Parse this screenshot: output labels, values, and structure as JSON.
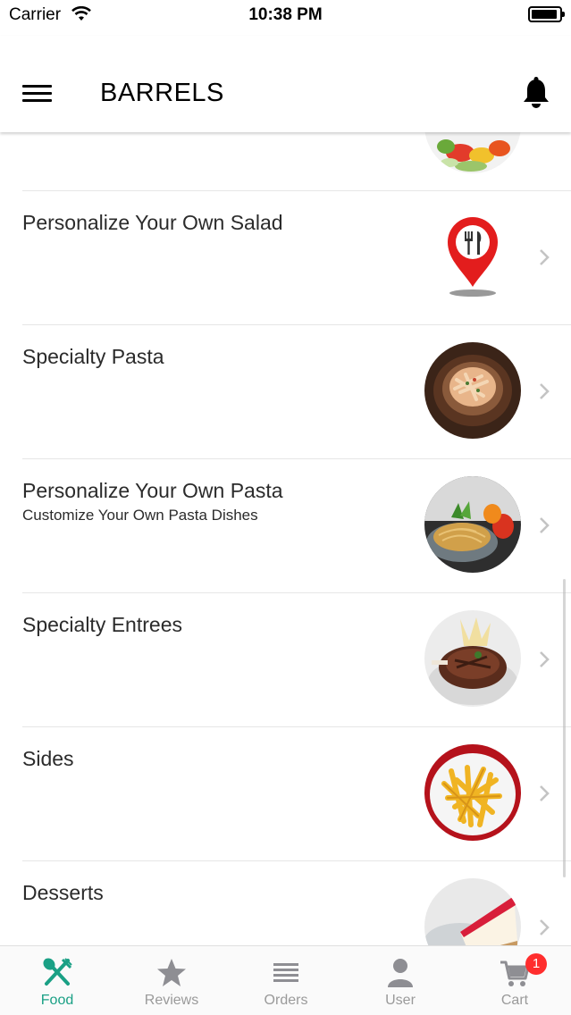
{
  "status_bar": {
    "carrier": "Carrier",
    "time": "10:38 PM"
  },
  "nav": {
    "title": "BARRELS",
    "menu_icon": "hamburger-menu-icon",
    "bell_icon": "bell-icon"
  },
  "menu_categories": [
    {
      "title": "Personalize Your Own Salad",
      "subtitle": "",
      "image": "map-pin-utensils-icon"
    },
    {
      "title": "Specialty Pasta",
      "subtitle": "",
      "image": "pasta-dish-photo"
    },
    {
      "title": "Personalize Your Own Pasta",
      "subtitle": "Customize Your Own Pasta Dishes",
      "image": "spaghetti-bowl-photo"
    },
    {
      "title": "Specialty Entrees",
      "subtitle": "",
      "image": "steak-photo"
    },
    {
      "title": "Sides",
      "subtitle": "",
      "image": "french-fries-photo"
    },
    {
      "title": "Desserts",
      "subtitle": "",
      "image": "cheesecake-photo"
    }
  ],
  "tab_bar": {
    "active_color": "#1aa085",
    "inactive_color": "#9a9a9a",
    "tabs": [
      {
        "label": "Food",
        "icon": "fork-spoon-icon",
        "active": true
      },
      {
        "label": "Reviews",
        "icon": "star-icon",
        "active": false
      },
      {
        "label": "Orders",
        "icon": "list-lines-icon",
        "active": false
      },
      {
        "label": "User",
        "icon": "user-icon",
        "active": false
      },
      {
        "label": "Cart",
        "icon": "cart-icon",
        "active": false,
        "badge": "1"
      }
    ]
  }
}
